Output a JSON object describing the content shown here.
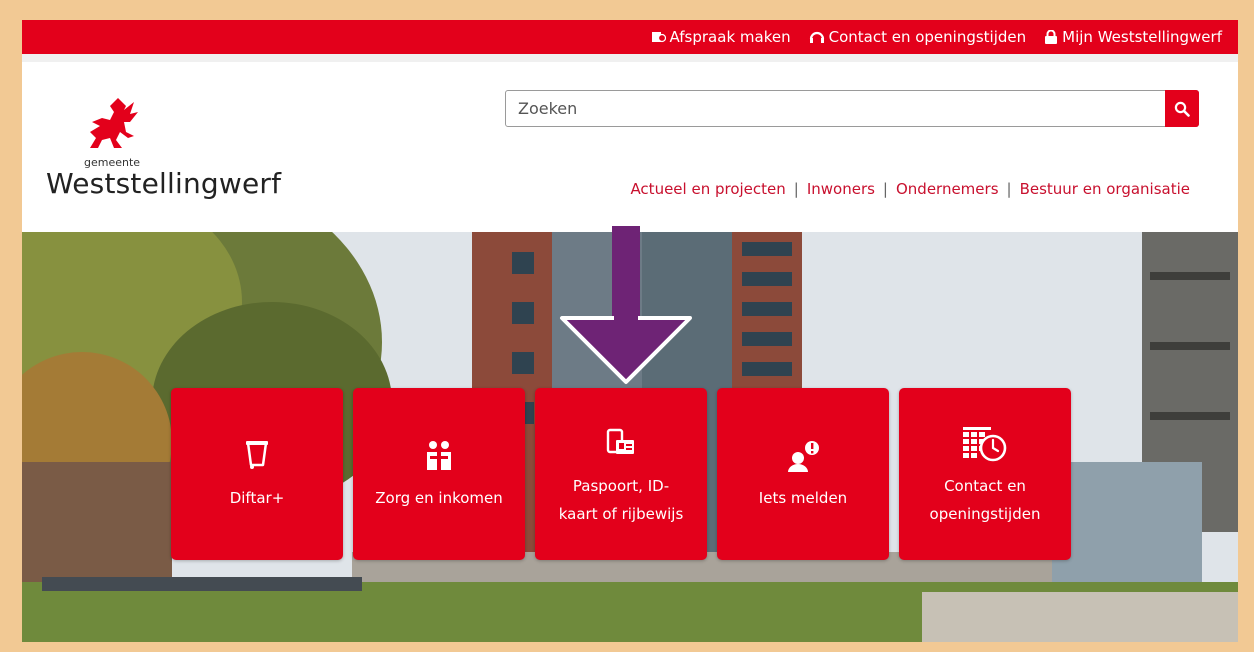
{
  "topbar": {
    "links": [
      {
        "label": "Afspraak maken",
        "icon": "calendar-clock-icon"
      },
      {
        "label": "Contact en openingstijden",
        "icon": "headset-icon"
      },
      {
        "label": "Mijn Weststellingwerf",
        "icon": "lock-icon"
      }
    ]
  },
  "logo": {
    "small": "gemeente",
    "big": "Weststellingwerf"
  },
  "search": {
    "placeholder": "Zoeken",
    "icon": "search-icon"
  },
  "nav": {
    "items": [
      "Actueel en projecten",
      "Inwoners",
      "Ondernemers",
      "Bestuur en organisatie"
    ]
  },
  "tiles": [
    {
      "lines": [
        "Diftar+"
      ],
      "icon": "waste-bin-icon"
    },
    {
      "lines": [
        "Zorg en inkomen"
      ],
      "icon": "people-care-icon"
    },
    {
      "lines": [
        "Paspoort, ID-",
        "kaart of rijbewijs"
      ],
      "icon": "id-card-icon"
    },
    {
      "lines": [
        "Iets melden"
      ],
      "icon": "person-alert-icon"
    },
    {
      "lines": [
        "Contact en",
        "openingstijden"
      ],
      "icon": "calendar-clock-icon"
    }
  ],
  "colors": {
    "brand_red": "#e3001b",
    "arrow": "#6e2375",
    "frame": "#f2c994"
  }
}
